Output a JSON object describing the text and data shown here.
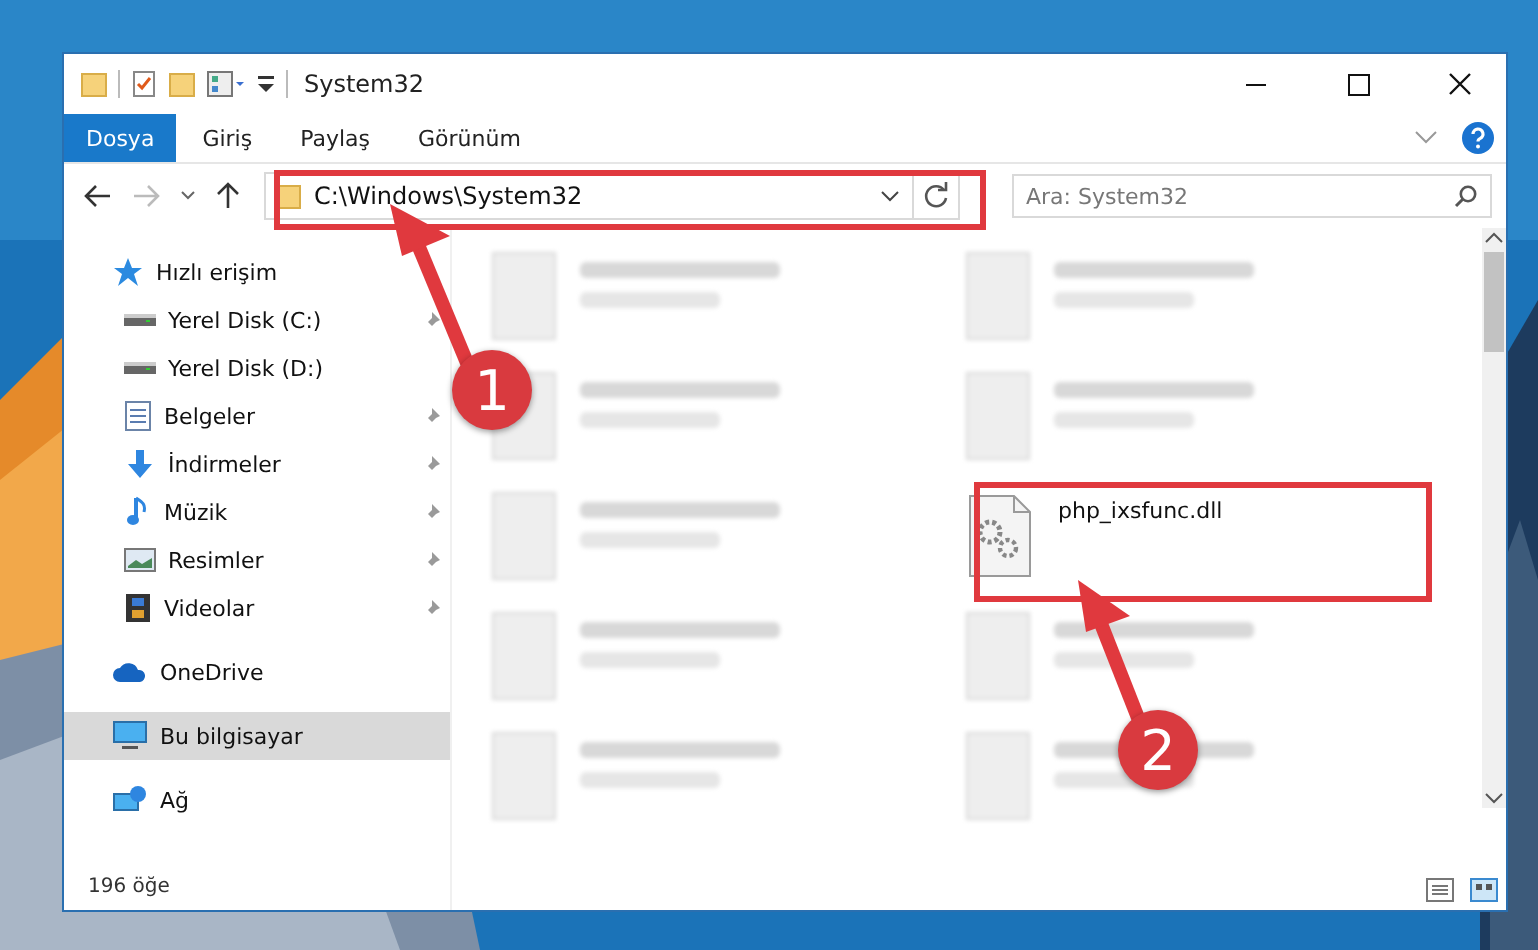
{
  "window": {
    "title": "System32"
  },
  "ribbon_tabs": [
    {
      "label": "Dosya",
      "selected": true
    },
    {
      "label": "Giriş",
      "selected": false
    },
    {
      "label": "Paylaş",
      "selected": false
    },
    {
      "label": "Görünüm",
      "selected": false
    }
  ],
  "address": {
    "value": "C:\\Windows\\System32"
  },
  "search": {
    "placeholder": "Ara: System32"
  },
  "sidebar": {
    "items": [
      {
        "label": "Hızlı erişim",
        "kind": "star",
        "selected": false,
        "pinned": false,
        "children": [
          {
            "label": "Yerel Disk (C:)",
            "kind": "drive",
            "selected": false,
            "pinned": true
          },
          {
            "label": "Yerel Disk (D:)",
            "kind": "drive",
            "selected": false,
            "pinned": false
          },
          {
            "label": "Belgeler",
            "kind": "docs",
            "selected": false,
            "pinned": true
          },
          {
            "label": "İndirmeler",
            "kind": "download",
            "selected": false,
            "pinned": true
          },
          {
            "label": "Müzik",
            "kind": "music",
            "selected": false,
            "pinned": true
          },
          {
            "label": "Resimler",
            "kind": "pictures",
            "selected": false,
            "pinned": true
          },
          {
            "label": "Videolar",
            "kind": "video",
            "selected": false,
            "pinned": true
          }
        ]
      },
      {
        "label": "OneDrive",
        "kind": "cloud",
        "selected": false,
        "pinned": false
      },
      {
        "label": "Bu bilgisayar",
        "kind": "computer",
        "selected": true,
        "pinned": false
      },
      {
        "label": "Ağ",
        "kind": "network",
        "selected": false,
        "pinned": false
      }
    ]
  },
  "files": [
    {
      "kind": "blurred"
    },
    {
      "kind": "blurred"
    },
    {
      "kind": "blurred"
    },
    {
      "kind": "blurred"
    },
    {
      "kind": "blurred"
    },
    {
      "kind": "file",
      "name": "php_ixsfunc.dll"
    },
    {
      "kind": "blurred"
    },
    {
      "kind": "blurred"
    },
    {
      "kind": "blurred"
    },
    {
      "kind": "blurred"
    }
  ],
  "status_bar": {
    "count": "196 öğe"
  },
  "annotations": [
    {
      "number": "1"
    },
    {
      "number": "2"
    }
  ]
}
